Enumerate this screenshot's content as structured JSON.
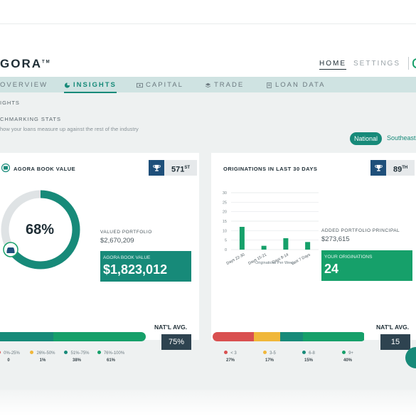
{
  "app": {
    "logo": "GORA",
    "logo_mark": "TM"
  },
  "topnav": {
    "home": "HOME",
    "settings": "SETTINGS"
  },
  "subnav": {
    "overview": "OVERVIEW",
    "insights": "INSIGHTS",
    "capital": "CAPITAL",
    "trade": "TRADE",
    "loan_data": "LOAN DATA"
  },
  "breadcrumb": "IGHTS",
  "section": {
    "title": "CHMARKING STATS",
    "subtitle": "how your loans measure up against the rest of the industry"
  },
  "region_toggle": {
    "selected": "National",
    "other": "Southeast"
  },
  "book_value": {
    "title": "AGORA BOOK VALUE",
    "rank": "571",
    "rank_suffix": "ST",
    "donut_percent": "68%",
    "donut_fraction": 0.68,
    "valued_label": "VALUED PORTFOLIO",
    "valued_value": "$2,670,209",
    "book_label": "AGORA BOOK VALUE",
    "book_value": "$1,823,012",
    "avg_label": "NAT'L AVG.",
    "avg_value": "75%",
    "legend": [
      {
        "label": "0%-25%",
        "pct": "0",
        "color": "#d95050"
      },
      {
        "label": "26%-50%",
        "pct": "1%",
        "color": "#f0b73a"
      },
      {
        "label": "51%-75%",
        "pct": "38%",
        "color": "#178a79"
      },
      {
        "label": "76%-100%",
        "pct": "61%",
        "color": "#16a06a"
      }
    ]
  },
  "originations": {
    "title": "ORIGINATIONS IN LAST 30 DAYS",
    "rank": "89",
    "rank_suffix": "TH",
    "added_label": "ADDED PORTFOLIO PRINCIPAL",
    "added_value": "$273,615",
    "your_label": "YOUR ORIGINATIONS",
    "your_value": "24",
    "avg_label": "NAT'L AVG.",
    "avg_value": "15",
    "legend": [
      {
        "label": "< 3",
        "pct": "27%",
        "color": "#d95050"
      },
      {
        "label": "3-5",
        "pct": "17%",
        "color": "#f0b73a"
      },
      {
        "label": "6-8",
        "pct": "15%",
        "color": "#178a79"
      },
      {
        "label": "9+",
        "pct": "40%",
        "color": "#16a06a"
      }
    ]
  },
  "chart_data": {
    "type": "bar",
    "categories": [
      "Days 22-30",
      "Days 15-21",
      "Days 8-14",
      "Last 7 Days"
    ],
    "values": [
      12,
      2,
      6,
      4
    ],
    "xlabel": "Originations Per Week",
    "ylabel": "",
    "ylim": [
      0,
      30
    ],
    "yticks": [
      "30",
      "25",
      "20",
      "15",
      "10",
      "5",
      "0"
    ],
    "color": "#16a06a"
  }
}
